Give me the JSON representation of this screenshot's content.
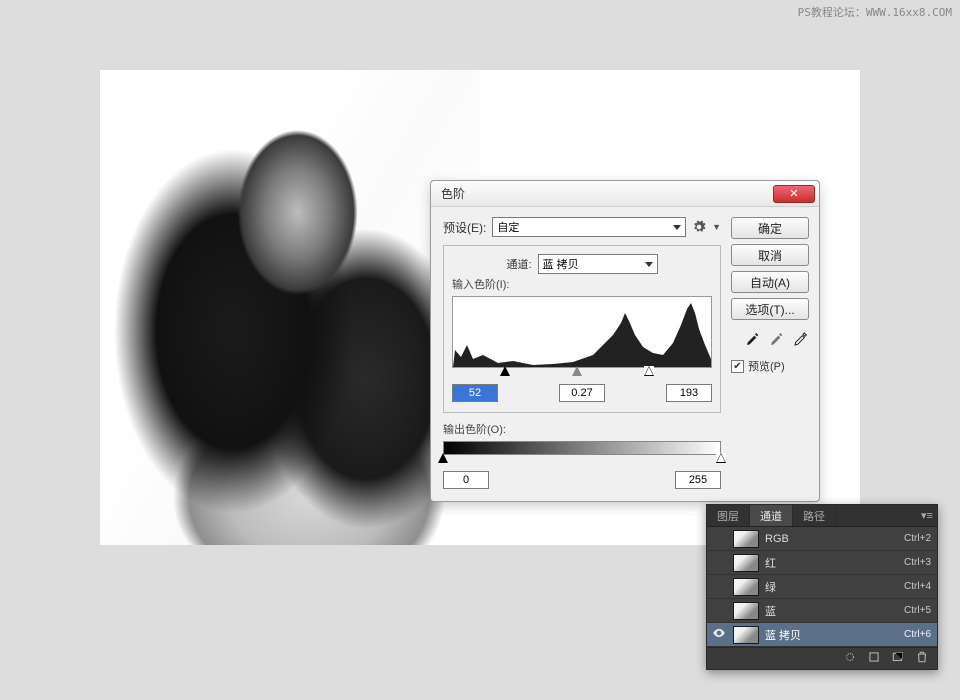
{
  "watermark": "PS教程论坛：WWW.16xx8.COM",
  "dialog": {
    "title": "色阶",
    "preset_label": "预设(E):",
    "preset_value": "自定",
    "channel_label": "通道:",
    "channel_value": "蓝 拷贝",
    "input_levels_label": "输入色阶(I):",
    "input_black": "52",
    "input_gamma": "0.27",
    "input_white": "193",
    "output_levels_label": "输出色阶(O):",
    "output_black": "0",
    "output_white": "255",
    "buttons": {
      "ok": "确定",
      "cancel": "取消",
      "auto": "自动(A)",
      "options": "选项(T)..."
    },
    "preview_label": "预览(P)",
    "preview_checked": true
  },
  "channels_panel": {
    "tabs": {
      "layers": "图层",
      "channels": "通道",
      "paths": "路径"
    },
    "active_tab": "channels",
    "items": [
      {
        "name": "RGB",
        "shortcut": "Ctrl+2",
        "visible": false,
        "selected": false
      },
      {
        "name": "红",
        "shortcut": "Ctrl+3",
        "visible": false,
        "selected": false
      },
      {
        "name": "绿",
        "shortcut": "Ctrl+4",
        "visible": false,
        "selected": false
      },
      {
        "name": "蓝",
        "shortcut": "Ctrl+5",
        "visible": false,
        "selected": false
      },
      {
        "name": "蓝 拷贝",
        "shortcut": "Ctrl+6",
        "visible": true,
        "selected": true
      }
    ]
  }
}
